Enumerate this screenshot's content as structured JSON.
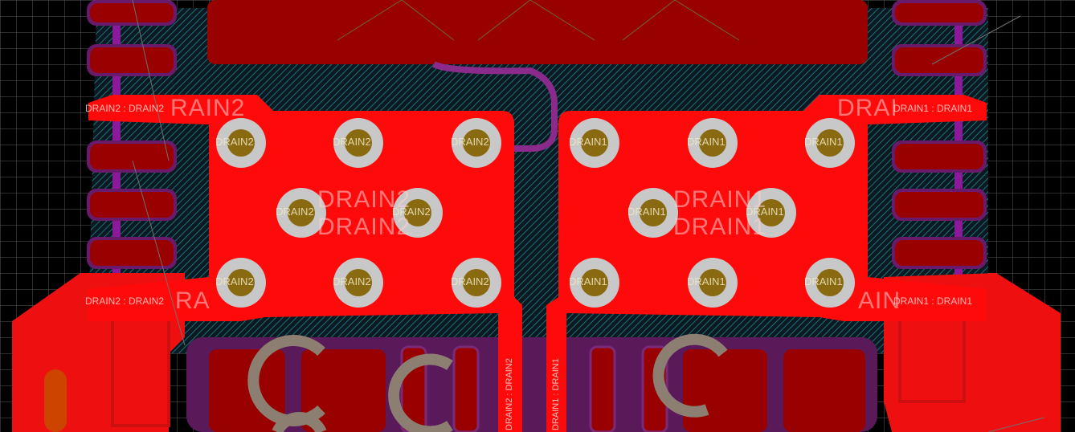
{
  "view": {
    "colors": {
      "background": "#000000",
      "grid": "#5a5a5a",
      "copper_top": "#ff0a0a",
      "copper_dark": "#990000",
      "solder_outline": "#7a2a7a",
      "hatch": "#1e6e7e",
      "via_ring": "#c8c8c8",
      "via_hole": "#8a6a10",
      "silkscreen": "#8c7f72"
    }
  },
  "net_labels": {
    "drain1": "DRAIN1",
    "drain2": "DRAIN2",
    "pin_drain1": "DRAIN1 : DRAIN1",
    "pin_drain2": "DRAIN2 : DRAIN2",
    "partial_left_top": "RAIN2",
    "partial_left_bottom": "RA",
    "partial_right_top": "DRAI",
    "partial_right_bottom": "AIN"
  },
  "vias": {
    "left_count": 8,
    "right_count": 8
  }
}
